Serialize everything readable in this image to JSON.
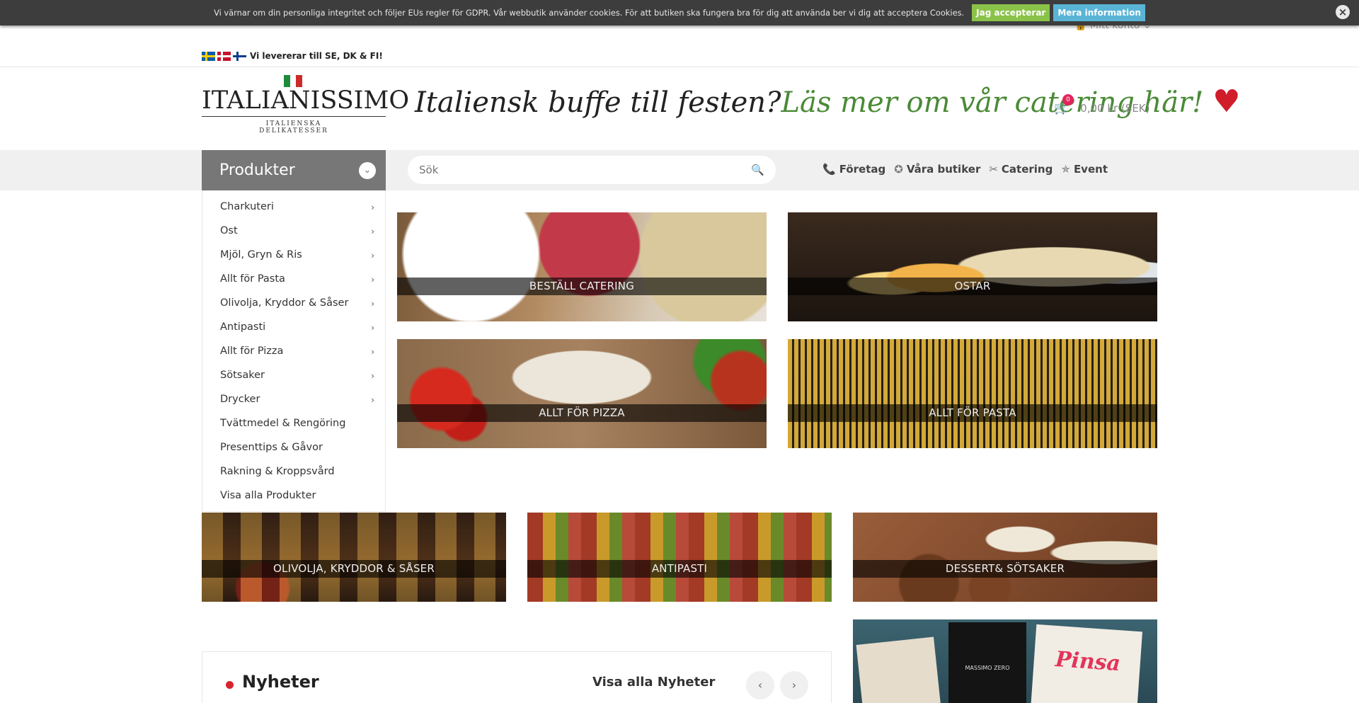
{
  "cookie": {
    "text": "Vi värnar om din personliga integritet och följer EUs regler för GDPR. Vår webbutik använder cookies. För att butiken ska fungera bra för dig att använda ber vi dig att acceptera Cookies.",
    "accept_label": "Jag accepterar",
    "info_label": "Mera information",
    "close_icon": "close-icon"
  },
  "header": {
    "account_label": "Mitt konto",
    "delivery_text": "Vi levererar till SE, DK & FI!",
    "flags": [
      "se-flag",
      "dk-flag",
      "fi-flag"
    ],
    "logo_name": "ITALIANISSIMO",
    "logo_sub": "ITALIENSKA DELIKATESSER",
    "promo_part1": "Italiensk buffe till festen?",
    "promo_part2": "Läs mer om vår catering här!",
    "cart_count": "0",
    "cart_total": "0,00 kr (SEK)"
  },
  "nav": {
    "products_label": "Produkter",
    "search_placeholder": "Sök",
    "links": [
      {
        "label": "Företag",
        "icon": "phone-icon"
      },
      {
        "label": "Våra butiker",
        "icon": "star-icon"
      },
      {
        "label": "Catering",
        "icon": "utensils-icon"
      },
      {
        "label": "Event",
        "icon": "star-outline-icon"
      }
    ]
  },
  "categories": [
    "Charkuteri",
    "Ost",
    "Mjöl, Gryn & Ris",
    "Allt för Pasta",
    "Olivolja, Kryddor & Såser",
    "Antipasti",
    "Allt för Pizza",
    "Sötsaker",
    "Drycker",
    "Tvättmedel & Rengöring",
    "Presenttips & Gåvor",
    "Rakning & Kroppsvård",
    "Visa alla Produkter"
  ],
  "tiles": {
    "catering": "BESTÄLL CATERING",
    "ostar": "OSTAR",
    "pizza": "ALLT FÖR PIZZA",
    "pasta": "ALLT FÖR PASTA",
    "oil": "OLIVOLJA, KRYDDOR & SÅSER",
    "antipasti": "ANTIPASTI",
    "dessert": "DESSERT& SÖTSAKER",
    "promo_brand": "MASSIMO ZERO",
    "promo_pinsa": "Pinsa"
  },
  "news": {
    "title": "Nyheter",
    "view_all": "Visa alla Nyheter"
  }
}
